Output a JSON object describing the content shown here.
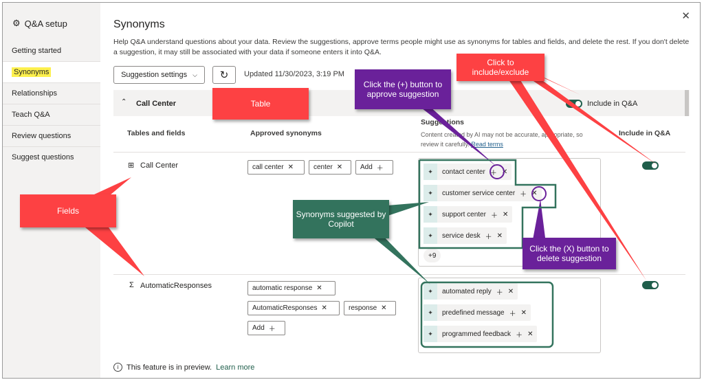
{
  "sidebar": {
    "title": "Q&A setup",
    "items": [
      {
        "label": "Getting started"
      },
      {
        "label": "Synonyms"
      },
      {
        "label": "Relationships"
      },
      {
        "label": "Teach Q&A"
      },
      {
        "label": "Review questions"
      },
      {
        "label": "Suggest questions"
      }
    ]
  },
  "header": {
    "title": "Synonyms",
    "description": "Help Q&A understand questions about your data. Review the suggestions, approve terms people might use as synonyms for tables and fields, and delete the rest. If you don't delete a suggestion, it may still be associated with your data if someone enters it into Q&A.",
    "close": "✕"
  },
  "toolbar": {
    "settings_label": "Suggestion settings",
    "updated": "Updated 11/30/2023, 3:19 PM"
  },
  "table": {
    "name": "Call Center",
    "include_label": "Include in Q&A",
    "columns": {
      "fields": "Tables and fields",
      "approved": "Approved synonyms",
      "suggestions": "Suggestions",
      "suggestions_note": "Content created by AI may not be accurate, appropriate, so review it carefully.",
      "read_terms": "Read terms",
      "include": "Include in Q&A"
    },
    "rows": [
      {
        "name": "Call Center",
        "approved": [
          "call center",
          "center"
        ],
        "add_label": "Add",
        "suggestions": [
          "contact center",
          "customer service center",
          "support center",
          "service desk"
        ],
        "more": "+9"
      },
      {
        "name": "AutomaticResponses",
        "approved": [
          "automatic response",
          "AutomaticResponses",
          "response"
        ],
        "add_label": "Add",
        "suggestions": [
          "automated reply",
          "predefined message",
          "programmed feedback"
        ]
      }
    ]
  },
  "footer": {
    "text": "This feature is in preview.",
    "link": "Learn more"
  },
  "callouts": {
    "table": "Table",
    "fields": "Fields",
    "approve": "Click the (+) button to approve suggestion",
    "include": "Click to include/exclude",
    "synonyms": "Synonyms suggested by Copilot",
    "delete": "Click the (X) button to delete suggestion"
  },
  "colors": {
    "toggle": "#1f5e4b",
    "callout_red": "#fd4143",
    "callout_purple": "#6a219a",
    "callout_green": "#33735d",
    "highlight": "#fdf04d"
  }
}
